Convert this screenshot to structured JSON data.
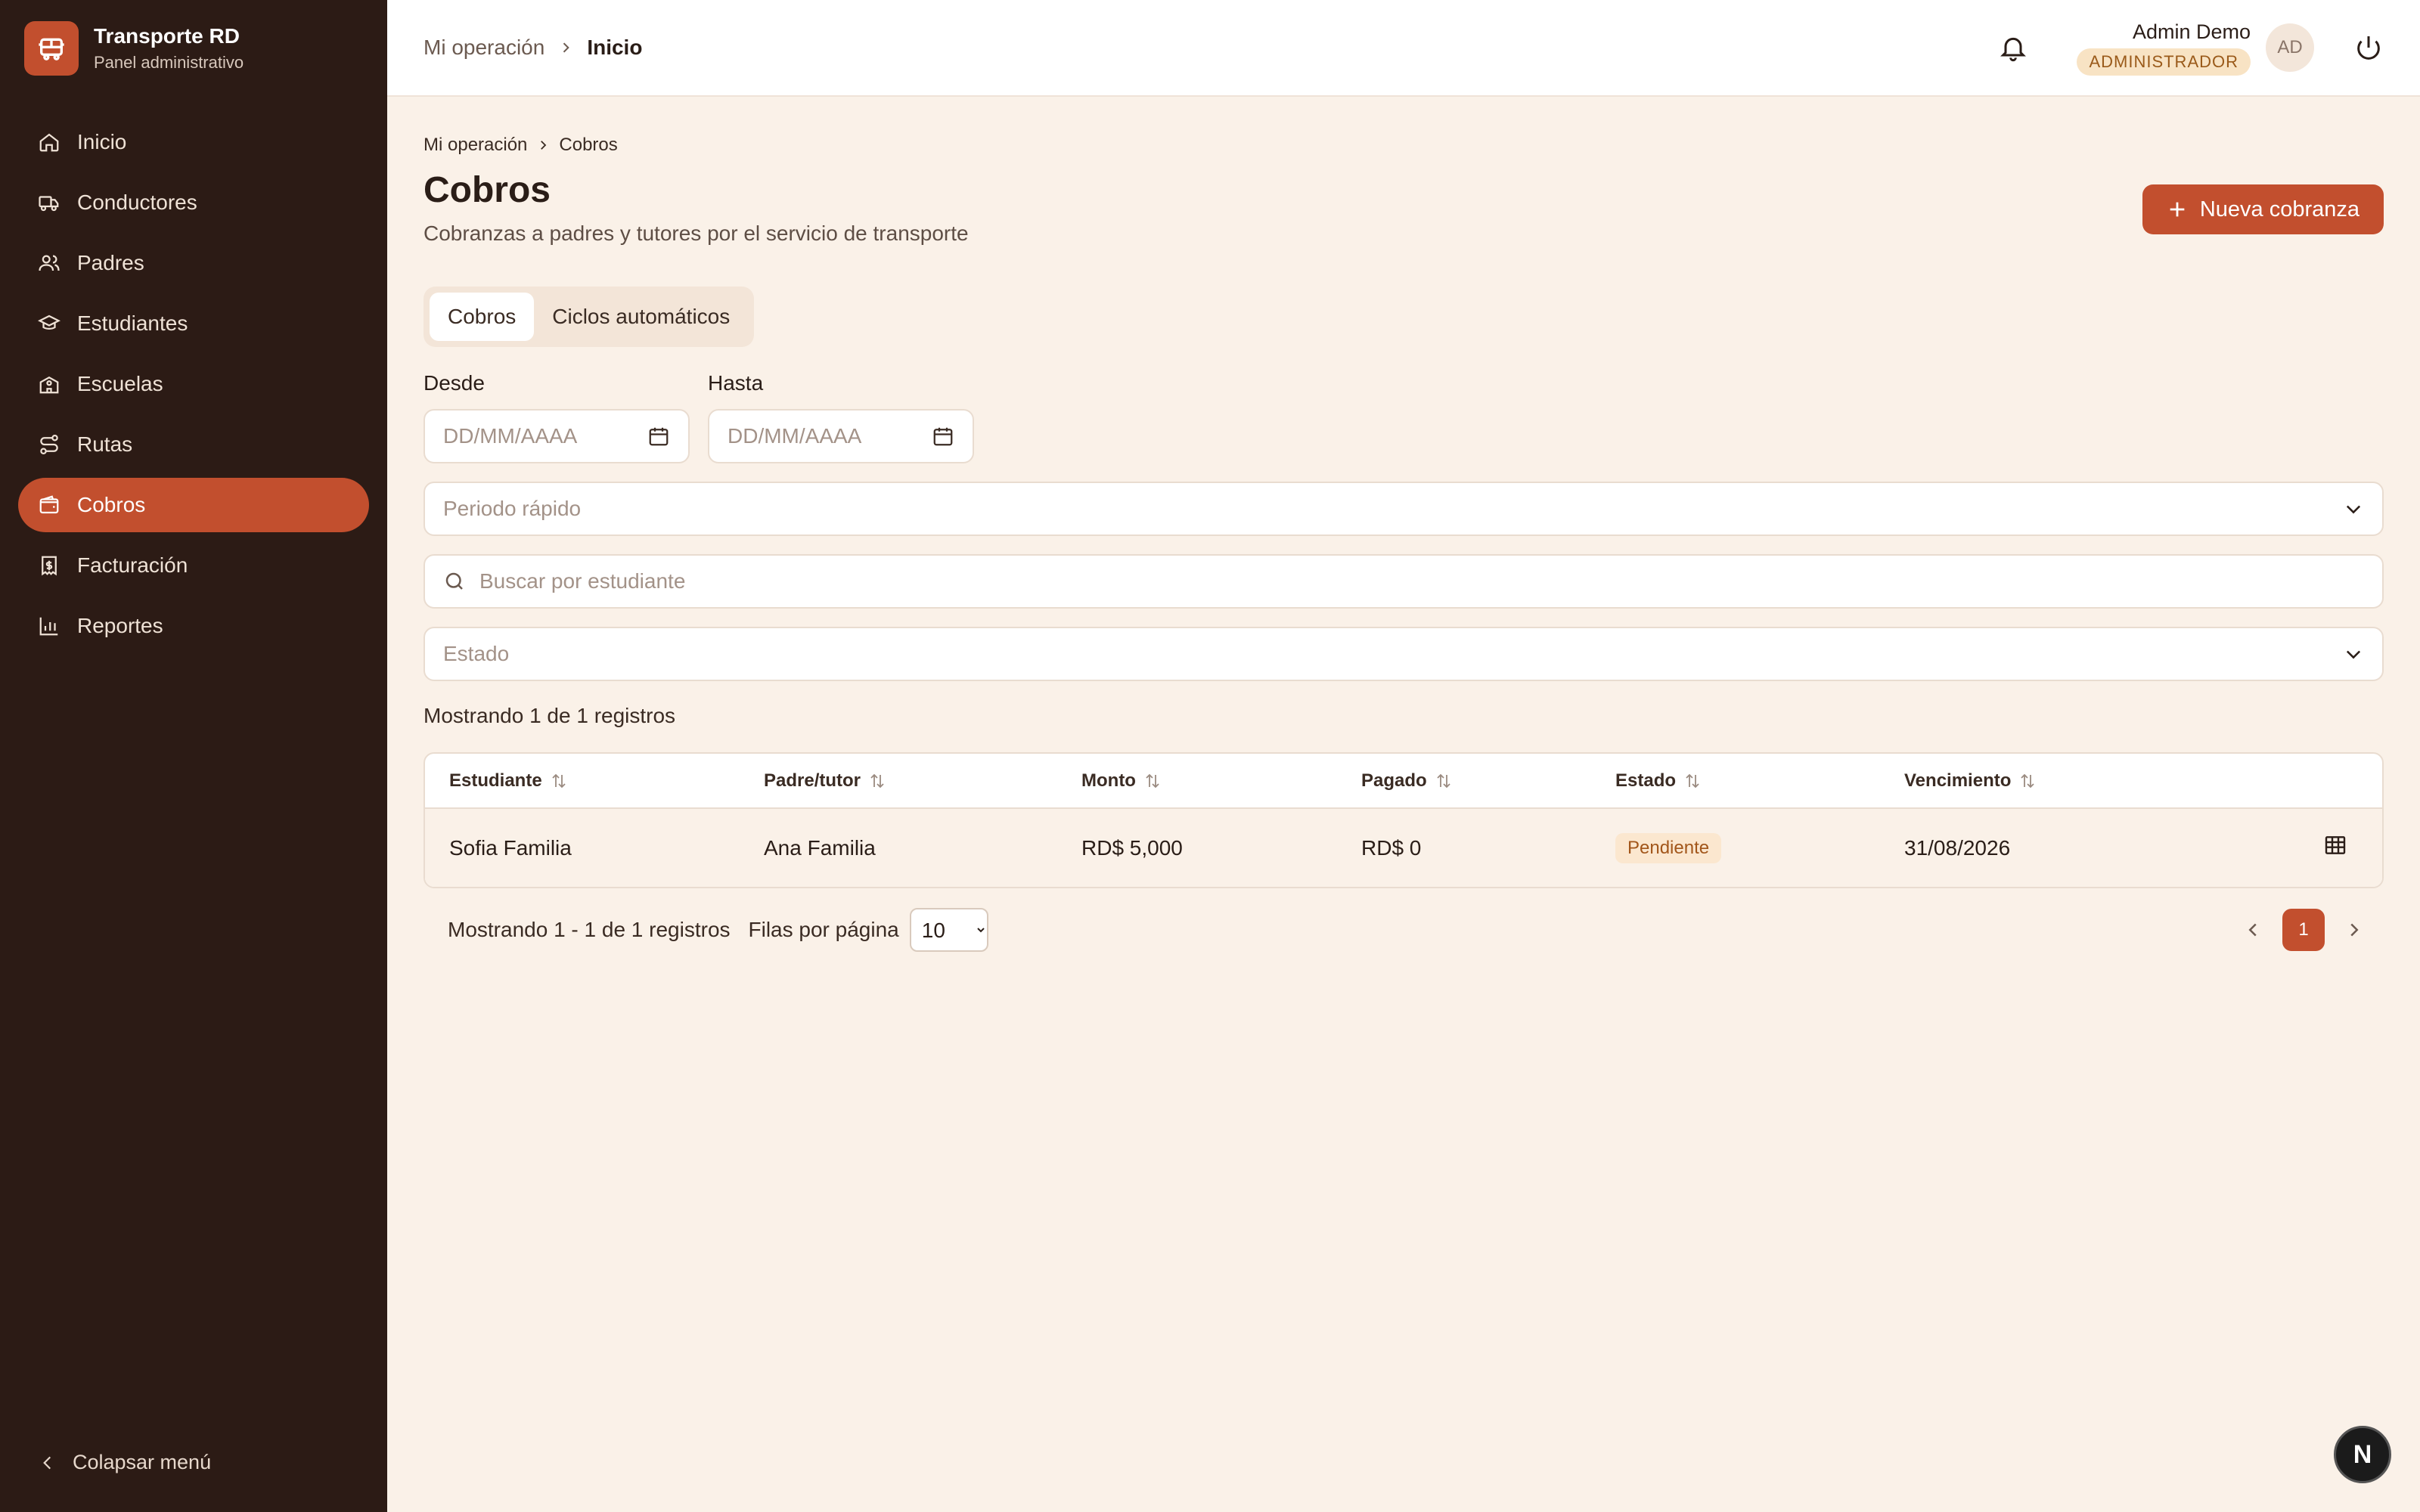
{
  "brand": {
    "title": "Transporte RD",
    "subtitle": "Panel administrativo"
  },
  "sidebar": {
    "items": [
      {
        "label": "Inicio",
        "icon": "home-icon"
      },
      {
        "label": "Conductores",
        "icon": "truck-icon"
      },
      {
        "label": "Padres",
        "icon": "users-icon"
      },
      {
        "label": "Estudiantes",
        "icon": "graduation-cap-icon"
      },
      {
        "label": "Escuelas",
        "icon": "school-icon"
      },
      {
        "label": "Rutas",
        "icon": "route-icon"
      },
      {
        "label": "Cobros",
        "icon": "wallet-icon",
        "active": true
      },
      {
        "label": "Facturación",
        "icon": "receipt-icon"
      },
      {
        "label": "Reportes",
        "icon": "bar-chart-icon"
      }
    ],
    "collapse_label": "Colapsar menú"
  },
  "topbar": {
    "breadcrumb": [
      "Mi operación",
      "Inicio"
    ],
    "user_name": "Admin Demo",
    "role": "ADMINISTRADOR",
    "avatar_initials": "AD"
  },
  "page": {
    "breadcrumb": [
      "Mi operación",
      "Cobros"
    ],
    "title": "Cobros",
    "subtitle": "Cobranzas a padres y tutores por el servicio de transporte",
    "new_button": "Nueva cobranza",
    "tabs": [
      "Cobros",
      "Ciclos automáticos"
    ],
    "active_tab": "Cobros"
  },
  "filters": {
    "from_label": "Desde",
    "to_label": "Hasta",
    "date_placeholder": "DD/MM/AAAA",
    "quick_period_placeholder": "Periodo rápido",
    "search_placeholder": "Buscar por estudiante",
    "status_placeholder": "Estado"
  },
  "summary": "Mostrando 1 de 1 registros",
  "table": {
    "columns": [
      "Estudiante",
      "Padre/tutor",
      "Monto",
      "Pagado",
      "Estado",
      "Vencimiento"
    ],
    "rows": [
      {
        "student": "Sofia Familia",
        "parent": "Ana Familia",
        "amount": "RD$ 5,000",
        "paid": "RD$ 0",
        "status": "Pendiente",
        "due": "31/08/2026"
      }
    ]
  },
  "pagination": {
    "range_text": "Mostrando 1 - 1 de 1 registros",
    "rows_per_page_label": "Filas por página",
    "rows_per_page": "10",
    "current_page": "1"
  },
  "colors": {
    "accent": "#c24f2e",
    "sidebar_bg": "#2c1b15",
    "page_bg": "#faf1e8"
  },
  "fab_label": "N"
}
